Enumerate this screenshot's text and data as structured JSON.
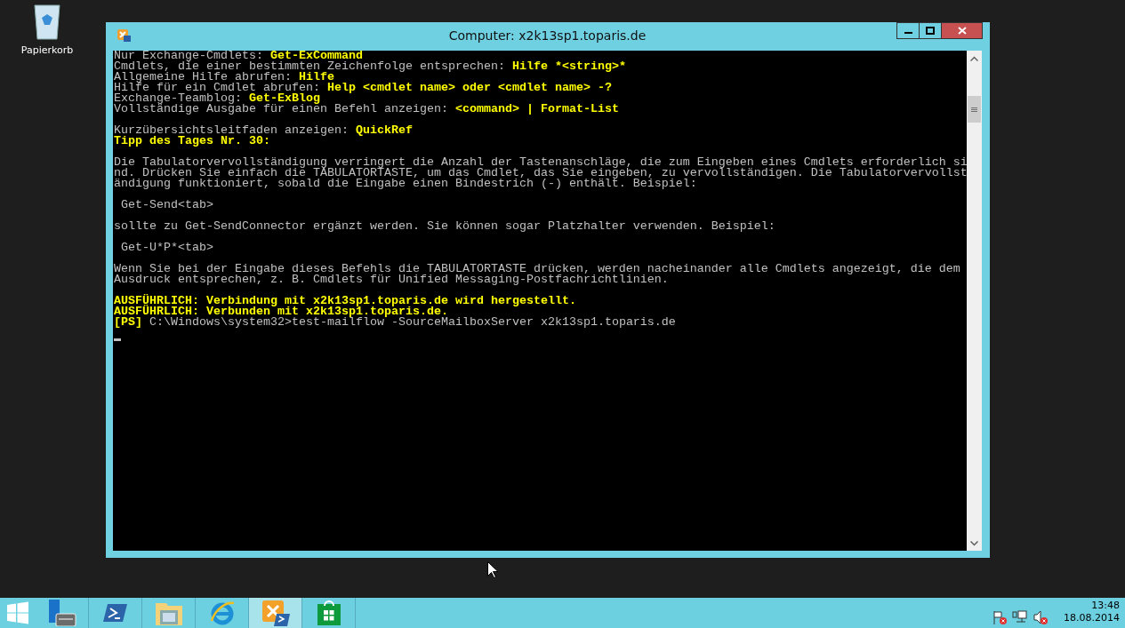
{
  "desktop": {
    "icons": [
      {
        "label": "Papierkorb"
      }
    ]
  },
  "window": {
    "title": "Computer: x2k13sp1.toparis.de",
    "console": {
      "blocks": [
        {
          "lines": [
            [
              {
                "text": "Nur Exchange-Cmdlets: ",
                "kind": "plain"
              },
              {
                "text": "Get-ExCommand",
                "kind": "highlight"
              }
            ],
            [
              {
                "text": "Cmdlets, die einer bestimmten Zeichenfolge entsprechen: ",
                "kind": "plain"
              },
              {
                "text": "Hilfe *<string>*",
                "kind": "highlight"
              }
            ],
            [
              {
                "text": "Allgemeine Hilfe abrufen: ",
                "kind": "plain"
              },
              {
                "text": "Hilfe",
                "kind": "highlight"
              }
            ],
            [
              {
                "text": "Hilfe für ein Cmdlet abrufen: ",
                "kind": "plain"
              },
              {
                "text": "Help <cmdlet name> oder <cmdlet name> -?",
                "kind": "highlight"
              }
            ],
            [
              {
                "text": "Exchange-Teamblog: ",
                "kind": "plain"
              },
              {
                "text": "Get-ExBlog",
                "kind": "highlight"
              }
            ],
            [
              {
                "text": "Vollständige Ausgabe für einen Befehl anzeigen: ",
                "kind": "plain"
              },
              {
                "text": "<command> | Format-List",
                "kind": "highlight"
              }
            ]
          ]
        },
        {
          "lines": [
            [
              {
                "text": "Kurzübersichtsleitfaden anzeigen: ",
                "kind": "plain"
              },
              {
                "text": "QuickRef",
                "kind": "highlight"
              }
            ],
            [
              {
                "text": "Tipp des Tages Nr. 30:",
                "kind": "highlight"
              }
            ]
          ]
        },
        {
          "lines": [
            [
              {
                "text": "Die Tabulatorvervollständigung verringert die Anzahl der Tastenanschläge, die zum Eingeben eines Cmdlets erforderlich si",
                "kind": "plain"
              }
            ],
            [
              {
                "text": "nd. Drücken Sie einfach die TABULATORTASTE, um das Cmdlet, das Sie eingeben, zu vervollständigen. Die Tabulatorvervollst",
                "kind": "plain"
              }
            ],
            [
              {
                "text": "ändigung funktioniert, sobald die Eingabe einen Bindestrich (-) enthält. Beispiel:",
                "kind": "plain"
              }
            ]
          ]
        },
        {
          "lines": [
            [
              {
                "text": " Get-Send<tab>",
                "kind": "plain"
              }
            ]
          ]
        },
        {
          "lines": [
            [
              {
                "text": "sollte zu Get-SendConnector ergänzt werden. Sie können sogar Platzhalter verwenden. Beispiel:",
                "kind": "plain"
              }
            ]
          ]
        },
        {
          "lines": [
            [
              {
                "text": " Get-U*P*<tab>",
                "kind": "plain"
              }
            ]
          ]
        },
        {
          "lines": [
            [
              {
                "text": "Wenn Sie bei der Eingabe dieses Befehls die TABULATORTASTE drücken, werden nacheinander alle Cmdlets angezeigt, die dem",
                "kind": "plain"
              }
            ],
            [
              {
                "text": "Ausdruck entsprechen, z. B. Cmdlets für Unified Messaging-Postfachrichtlinien.",
                "kind": "plain"
              }
            ]
          ]
        },
        {
          "lines": [
            [
              {
                "text": "AUSFÜHRLICH: Verbindung mit x2k13sp1.toparis.de wird hergestellt.",
                "kind": "highlight"
              }
            ],
            [
              {
                "text": "AUSFÜHRLICH: Verbunden mit x2k13sp1.toparis.de.",
                "kind": "highlight"
              }
            ],
            [
              {
                "text": "[PS]",
                "kind": "highlight"
              },
              {
                "text": " C:\\Windows\\system32>test-mailflow -SourceMailboxServer x2k13sp1.toparis.de",
                "kind": "plain"
              }
            ]
          ]
        }
      ]
    }
  },
  "taskbar": {
    "apps": [
      {
        "active": false
      },
      {
        "active": false
      },
      {
        "active": false
      },
      {
        "active": false
      },
      {
        "active": true
      },
      {
        "active": false
      }
    ],
    "clock": {
      "time": "13:48",
      "date": "18.08.2014"
    }
  }
}
